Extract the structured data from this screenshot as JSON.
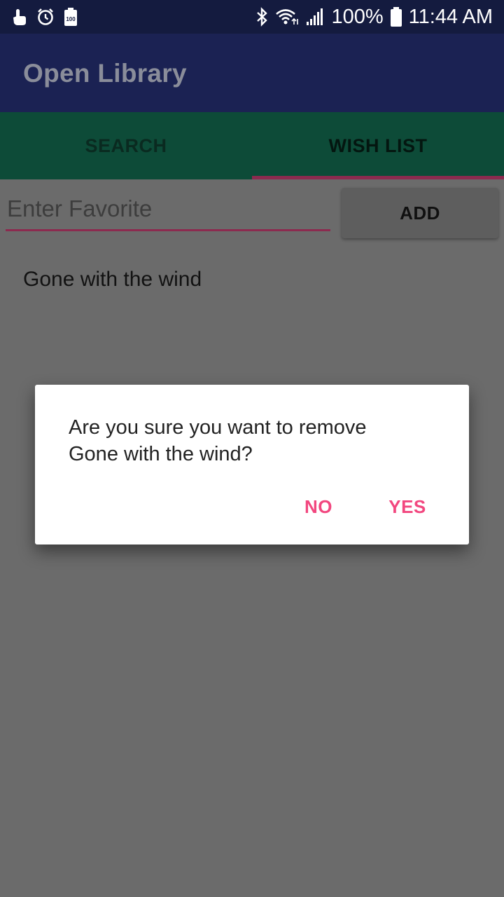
{
  "status_bar": {
    "icons_left": [
      "hand-pointer-icon",
      "alarm-icon",
      "battery-100-icon"
    ],
    "icons_right": [
      "bluetooth-icon",
      "wifi-icon",
      "signal-icon",
      "battery-icon"
    ],
    "battery_percent": "100%",
    "time": "11:44 AM"
  },
  "app_bar": {
    "title": "Open Library"
  },
  "tabs": [
    {
      "label": "SEARCH",
      "selected": false
    },
    {
      "label": "WISH LIST",
      "selected": true
    }
  ],
  "wish_form": {
    "input_placeholder": "Enter Favorite",
    "input_value": "",
    "add_label": "ADD"
  },
  "wish_list": [
    {
      "title": "Gone with the wind"
    }
  ],
  "dialog": {
    "message": "Are you sure you want to remove Gone with the wind?",
    "no_label": "NO",
    "yes_label": "YES"
  },
  "colors": {
    "accent": "#f2477f",
    "primary": "#1b2253",
    "tab_bar": "#0d4b38",
    "status_bar": "#141b3f",
    "scrim_background": "#6b6b6b"
  }
}
